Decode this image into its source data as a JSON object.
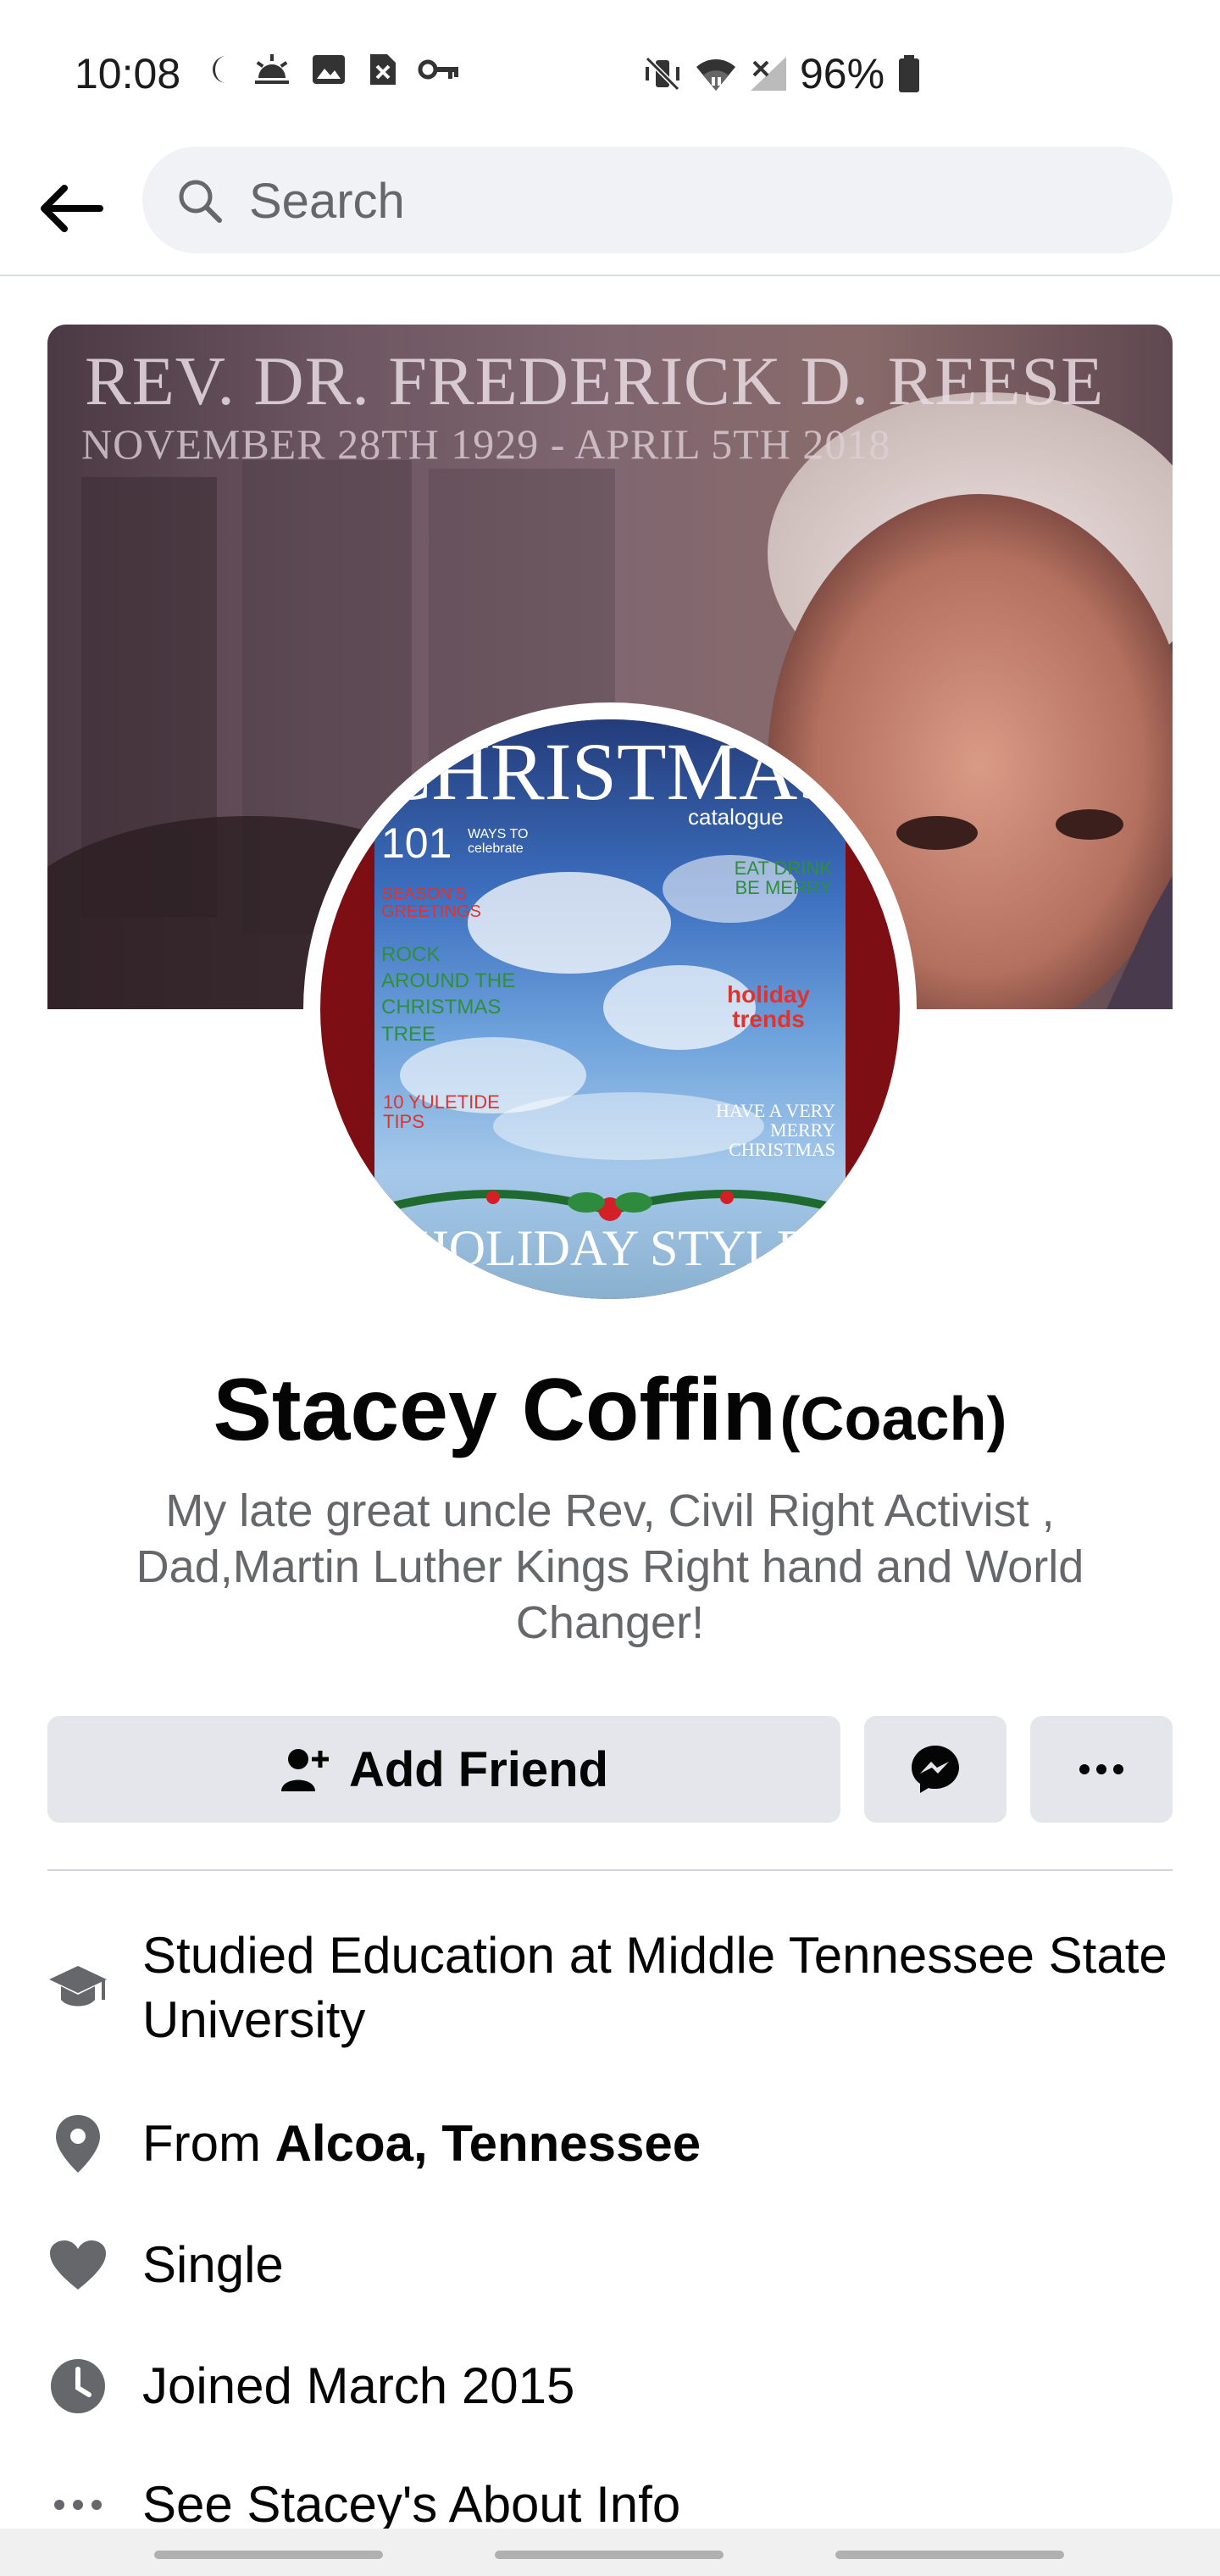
{
  "status_bar": {
    "time": "10:08",
    "battery": "96%"
  },
  "header": {
    "search_placeholder": "Search"
  },
  "cover": {
    "title": "REV. DR. FREDERICK D. REESE",
    "subtitle": "NOVEMBER 28TH 1929 - APRIL 5TH 2018"
  },
  "avatar": {
    "magazine_title": "CHRISTMAS",
    "magazine_sub": "catalogue",
    "num": "101",
    "num_sub": "WAYS TO celebrate",
    "seasons": "SEASON'S GREETINGS",
    "rock": "ROCK AROUND THE CHRISTMAS TREE",
    "tips": "10 YULETIDE TIPS",
    "eat": "EAT DRINK BE MERRY",
    "trends": "holiday trends",
    "merry": "HAVE A VERY MERRY CHRISTMAS",
    "bottom": "HOLIDAY STYLE"
  },
  "profile": {
    "name": "Stacey Coffin",
    "nickname": "(Coach)",
    "bio": "My late great uncle Rev, Civil Right Activist , Dad,Martin Luther Kings Right hand and World Changer!"
  },
  "actions": {
    "add_friend": "Add Friend"
  },
  "details": {
    "education": "Studied Education at Middle Tennessee State University",
    "from_prefix": "From ",
    "from_place": "Alcoa, Tennessee",
    "relationship": "Single",
    "joined": "Joined March 2015",
    "about": "See Stacey's About Info"
  },
  "colors": {
    "button_bg": "#e4e6eb",
    "search_bg": "#f0f2f5",
    "icon_gray": "#65676b"
  }
}
